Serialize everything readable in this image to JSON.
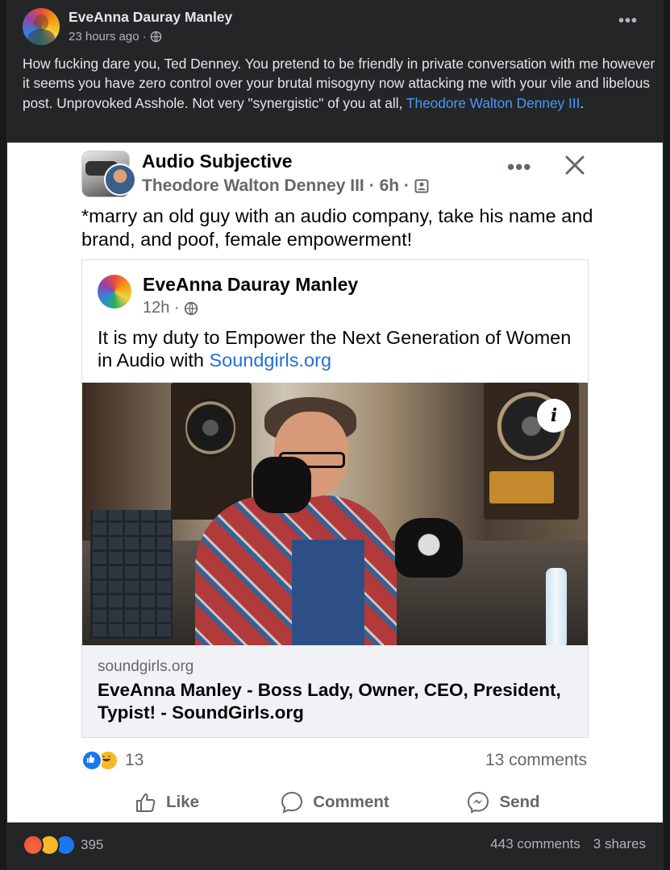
{
  "post": {
    "author": "EveAnna Dauray Manley",
    "time": "23 hours ago ·",
    "body_text": "How fucking dare you, Ted Denney. You pretend to be friendly in private conversation with me however it seems you have zero control over your brutal misogyny now attacking me with your vile and libelous post. Unprovoked Asshole. Not very \"synergistic\" of you at all, ",
    "mention": "Theodore Walton Denney III",
    "body_end": ".",
    "more_icon": "more-horizontal-icon",
    "privacy_icon": "globe-icon"
  },
  "screenshot": {
    "page_name": "Audio Subjective",
    "poster": "Theodore Walton Denney III",
    "meta_sep": "· 6h ·",
    "caption": "*marry an old guy with an audio company, take his name and brand, and poof, female empowerment!",
    "shared_post": {
      "author": "EveAnna Dauray Manley",
      "time": "12h ·",
      "text": "It is my duty to Empower the Next Generation of Women in Audio with ",
      "link": "Soundgirls.org",
      "photo_badge": "i",
      "link_domain": "soundgirls.org",
      "link_title": "EveAnna Manley - Boss Lady, Owner, CEO, President, Typist! - SoundGirls.org"
    },
    "reaction_count": "13",
    "comments": "13 comments",
    "actions": {
      "like": "Like",
      "comment": "Comment",
      "send": "Send"
    }
  },
  "footer": {
    "reaction_count": "395",
    "comments": "443 comments",
    "shares": "3 shares"
  },
  "colors": {
    "background": "#18191a",
    "card": "#242526",
    "text_primary": "#e4e6eb",
    "text_secondary": "#b0b3b8",
    "link": "#4599ff",
    "fb_blue": "#1877f2"
  }
}
